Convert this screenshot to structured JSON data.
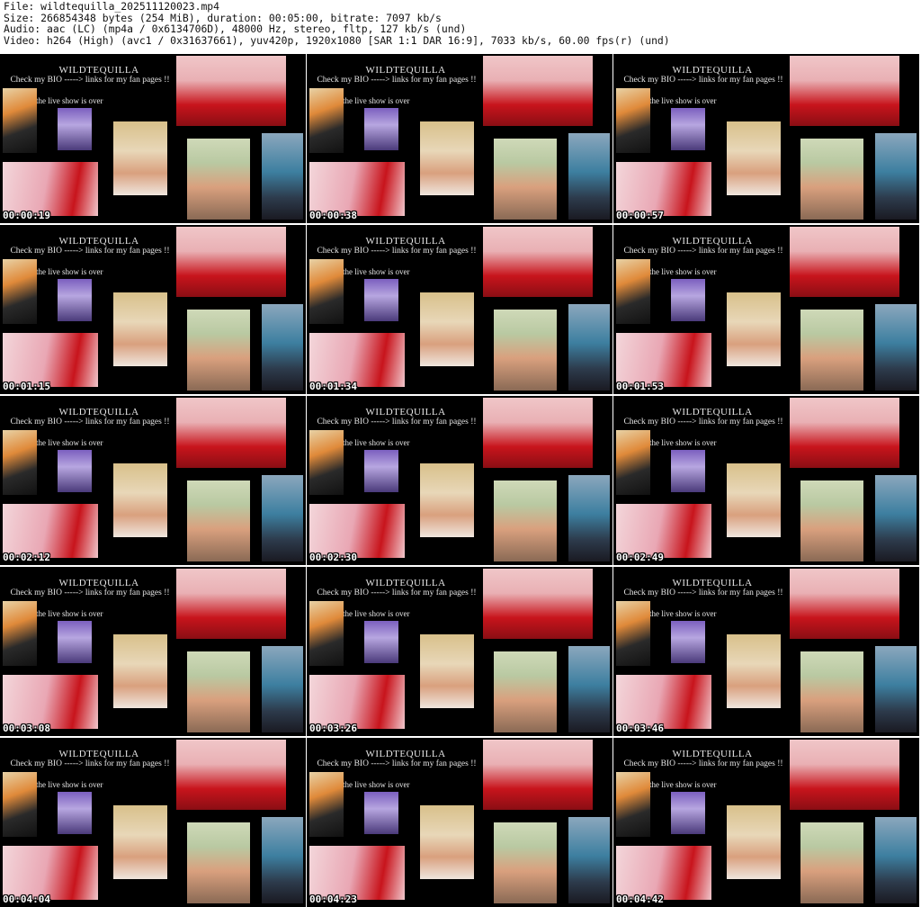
{
  "header": {
    "file_line": "File: wildtequilla_202511120023.mp4",
    "size_line": "Size: 266854348 bytes (254 MiB), duration: 00:05:00, bitrate: 7097 kb/s",
    "audio_line": "Audio: aac (LC) (mp4a / 0x6134706D), 48000 Hz, stereo, fltp, 127 kb/s (und)",
    "video_line": "Video: h264 (High) (avc1 / 0x31637661), yuv420p, 1920x1080 [SAR 1:1 DAR 16:9], 7033 kb/s, 60.00 fps(r) (und)"
  },
  "watermark": {
    "title": "WILDTEQUILLA",
    "bio_text": "Check my BIO -----> links for my fan pages !!",
    "status_text": "the live show is over"
  },
  "colors": {
    "background": "#000000",
    "latex_red": "#c8141c",
    "pink_room": "#e9a7b4",
    "skin": "#d9a07e",
    "denim_blue": "#3d7fa0",
    "blonde": "#d8c08a"
  },
  "thumbnails": [
    {
      "timestamp": "00:00:19"
    },
    {
      "timestamp": "00:00:38"
    },
    {
      "timestamp": "00:00:57"
    },
    {
      "timestamp": "00:01:15"
    },
    {
      "timestamp": "00:01:34"
    },
    {
      "timestamp": "00:01:53"
    },
    {
      "timestamp": "00:02:12"
    },
    {
      "timestamp": "00:02:30"
    },
    {
      "timestamp": "00:02:49"
    },
    {
      "timestamp": "00:03:08"
    },
    {
      "timestamp": "00:03:26"
    },
    {
      "timestamp": "00:03:46"
    },
    {
      "timestamp": "00:04:04"
    },
    {
      "timestamp": "00:04:23"
    },
    {
      "timestamp": "00:04:42"
    }
  ]
}
